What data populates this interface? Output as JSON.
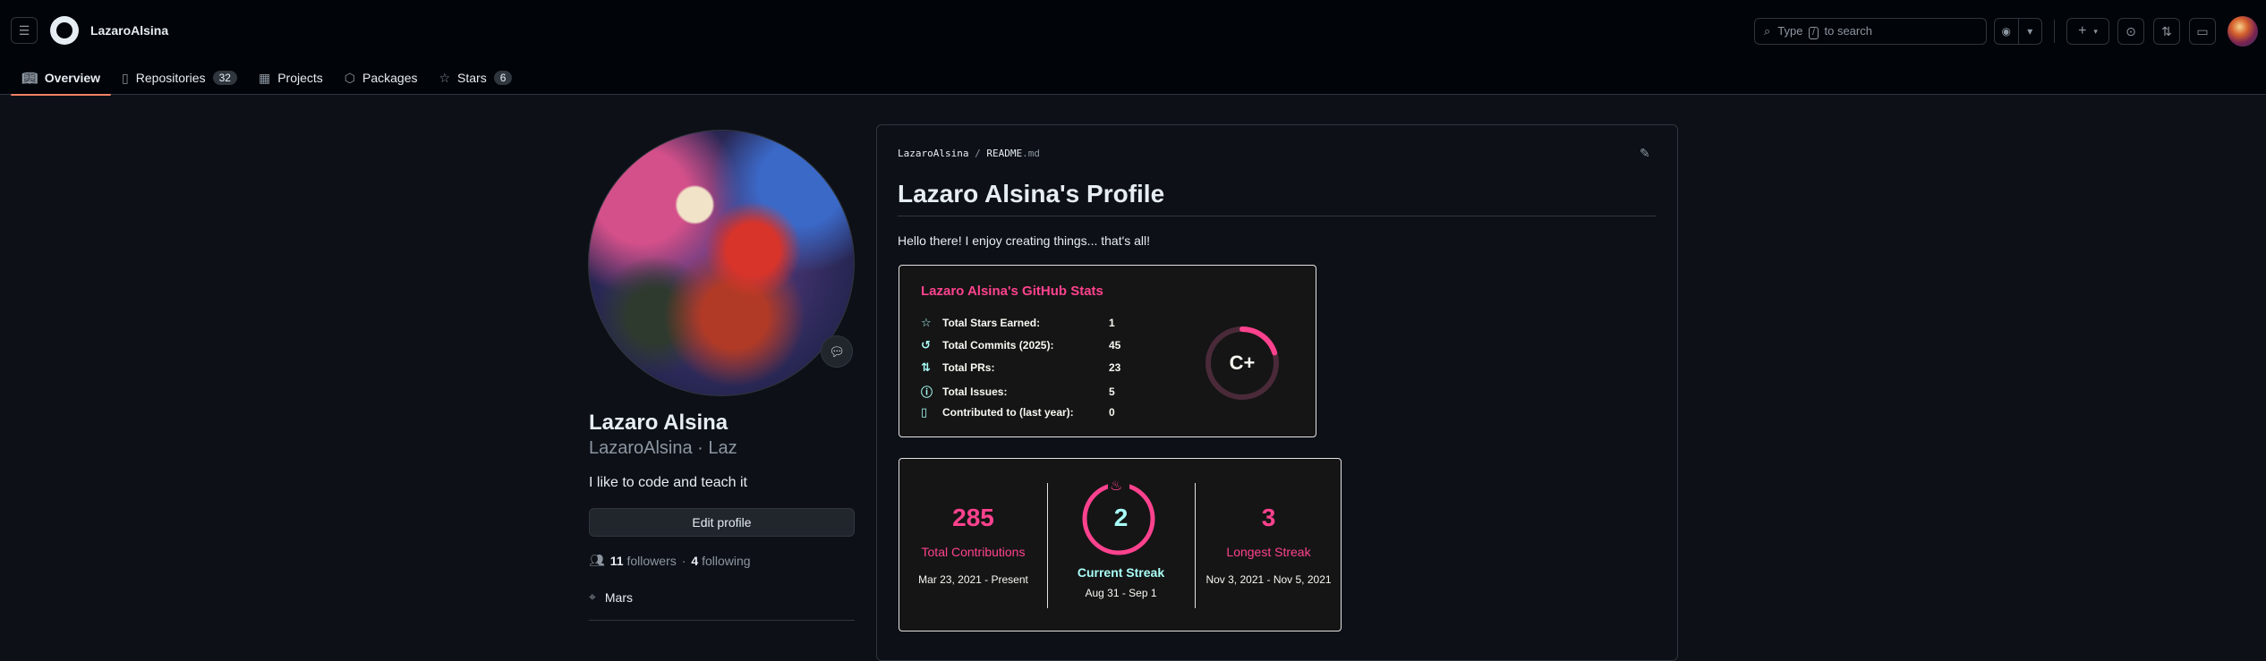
{
  "header": {
    "username": "LazaroAlsina",
    "search_prefix": "Type",
    "search_key": "/",
    "search_suffix": "to search"
  },
  "tabs": [
    {
      "label": "Overview",
      "icon": "book-icon",
      "count": ""
    },
    {
      "label": "Repositories",
      "icon": "repo-icon",
      "count": "32"
    },
    {
      "label": "Projects",
      "icon": "table-icon",
      "count": ""
    },
    {
      "label": "Packages",
      "icon": "package-icon",
      "count": ""
    },
    {
      "label": "Stars",
      "icon": "star-icon",
      "count": "6"
    }
  ],
  "profile": {
    "name": "Lazaro Alsina",
    "login": "LazaroAlsina · Laz",
    "bio": "I like to code and teach it",
    "edit_label": "Edit profile",
    "followers_count": "11",
    "followers_label": "followers",
    "following_count": "4",
    "following_label": "following",
    "separator": "·",
    "location": "Mars"
  },
  "readme": {
    "path_owner": "LazaroAlsina",
    "path_sep": "/",
    "path_file": "README",
    "path_ext": ".md",
    "title": "Lazaro Alsina's Profile",
    "intro": "Hello there! I enjoy creating things... that's all!"
  },
  "stats_card": {
    "title": "Lazaro Alsina's GitHub Stats",
    "rows": [
      {
        "label": "Total Stars Earned:",
        "value": "1",
        "icon": "star-icon"
      },
      {
        "label": "Total Commits (2025):",
        "value": "45",
        "icon": "history-icon"
      },
      {
        "label": "Total PRs:",
        "value": "23",
        "icon": "pull-request-icon"
      },
      {
        "label": "Total Issues:",
        "value": "5",
        "icon": "issue-icon"
      },
      {
        "label": "Contributed to (last year):",
        "value": "0",
        "icon": "repo-icon"
      }
    ],
    "grade": "C+",
    "grade_progress": 0.2,
    "colors": {
      "title": "#fe428e",
      "icon": "#a9fef7",
      "text": "#f8f8f2",
      "bg": "#151515"
    }
  },
  "streak_card": {
    "total": {
      "value": "285",
      "label": "Total Contributions",
      "range": "Mar 23, 2021 - Present"
    },
    "current": {
      "value": "2",
      "label": "Current Streak",
      "range": "Aug 31 - Sep 1"
    },
    "longest": {
      "value": "3",
      "label": "Longest Streak",
      "range": "Nov 3, 2021 - Nov 5, 2021"
    },
    "colors": {
      "accent": "#fe428e",
      "current": "#a9fef7"
    }
  }
}
